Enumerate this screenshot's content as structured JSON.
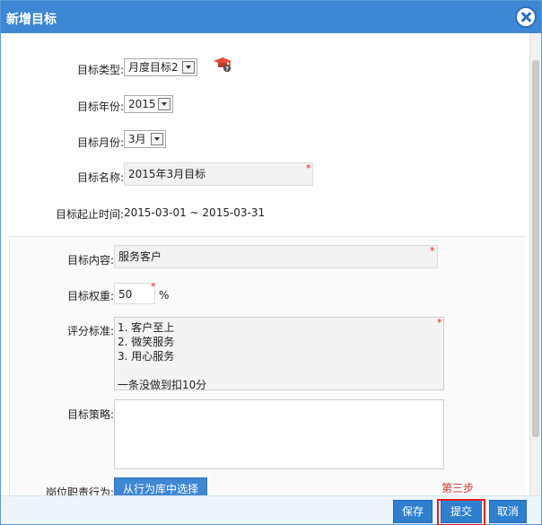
{
  "dialog": {
    "title": "新增目标",
    "close_icon": "close-circle-icon"
  },
  "form": {
    "target_type": {
      "label": "目标类型:",
      "value": "月度目标2",
      "help_icon": "graduation-cap-help-icon"
    },
    "target_year": {
      "label": "目标年份:",
      "value": "2015"
    },
    "target_month": {
      "label": "目标月份:",
      "value": "3月"
    },
    "target_name": {
      "label": "目标名称:",
      "value": "2015年3月目标",
      "required": "*"
    },
    "date_range": {
      "label": "目标起止时间:",
      "value": "2015-03-01 ~ 2015-03-31"
    },
    "content": {
      "label": "目标内容:",
      "value": "服务客户",
      "required": "*"
    },
    "weight": {
      "label": "目标权重:",
      "value": "50",
      "unit": "%",
      "required": "*"
    },
    "criteria": {
      "label": "评分标准:",
      "value": "1. 客户至上\n2. 微笑服务\n3. 用心服务\n\n一条没做到扣10分",
      "required": "*"
    },
    "strategy": {
      "label": "目标策略:",
      "value": ""
    },
    "behavior": {
      "label": "岗位职责行为:",
      "button": "从行为库中选择"
    }
  },
  "footer": {
    "save": "保存",
    "submit": "提交",
    "cancel": "取消",
    "annotation": "第三步"
  },
  "colors": {
    "accent": "#3d87d3",
    "required": "#e02020"
  }
}
